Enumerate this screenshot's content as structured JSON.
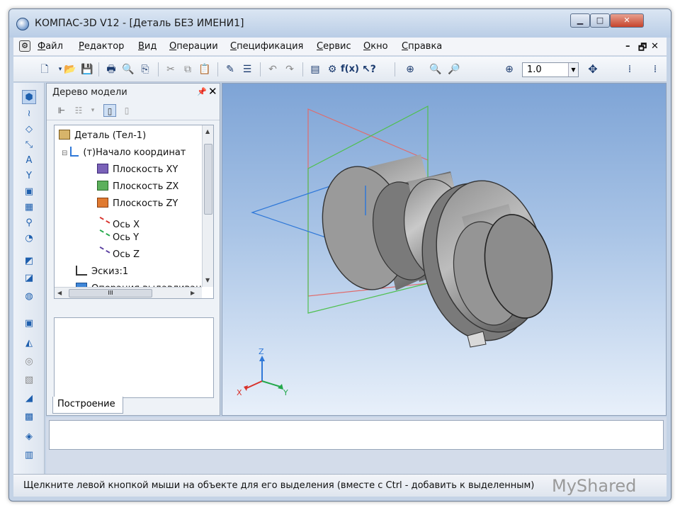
{
  "window": {
    "title": "КОМПАС-3D V12 - [Деталь БЕЗ ИМЕНИ1]",
    "controls": {
      "minimize": "▁",
      "maximize": "□",
      "close": "✕"
    }
  },
  "menu": {
    "items": [
      "Файл",
      "Редактор",
      "Вид",
      "Операции",
      "Спецификация",
      "Сервис",
      "Окно",
      "Справка"
    ],
    "mdi_controls": [
      "–",
      "🗗",
      "✕"
    ]
  },
  "toolbar": {
    "icons": [
      "new-document",
      "open-folder",
      "save",
      "print",
      "print-preview",
      "export",
      "cut",
      "copy",
      "paste",
      "format-brush",
      "properties",
      "undo",
      "redo",
      "manager",
      "variables",
      "formula",
      "context-help",
      "zoom-window",
      "zoom-in",
      "zoom-out",
      "zoom-scale",
      "pan"
    ],
    "formula_label": "f(x)",
    "zoom_value": "1.0"
  },
  "left_toolbar": {
    "icons": [
      "view-3d",
      "sketch-curve",
      "geometry",
      "dimensions",
      "designations",
      "edit",
      "parameterization",
      "measure",
      "filter",
      "library",
      "extrude",
      "rotate",
      "kinematic",
      "loft",
      "cut-extrude",
      "hole",
      "shell",
      "mirror",
      "array",
      "surfaces",
      "spec"
    ]
  },
  "model_tree": {
    "caption": "Дерево модели",
    "pin": "ᵾ",
    "close": "✕",
    "nodes": [
      {
        "label": "Деталь (Тел-1)",
        "icon": "part-icon"
      },
      {
        "label": "(т)Начало координат",
        "icon": "origin-icon"
      },
      {
        "label": "Плоскость XY",
        "icon": "plane-xy-icon"
      },
      {
        "label": "Плоскость ZX",
        "icon": "plane-zx-icon"
      },
      {
        "label": "Плоскость ZY",
        "icon": "plane-zy-icon"
      },
      {
        "label": "Ось X",
        "icon": "axis-x-icon"
      },
      {
        "label": "Ось Y",
        "icon": "axis-y-icon"
      },
      {
        "label": "Ось Z",
        "icon": "axis-z-icon"
      },
      {
        "label": "Эскиз:1",
        "icon": "sketch-icon"
      },
      {
        "label": "Операция выдавливания",
        "icon": "extrusion-icon"
      }
    ],
    "hscroll_thumb": "III",
    "tab": "Построение"
  },
  "viewport": {
    "axes": {
      "x": "X",
      "y": "Y",
      "z": "Z"
    },
    "axis_colors": {
      "x": "#d8322b",
      "y": "#22a84a",
      "z": "#2f78d8"
    },
    "plane_colors": {
      "xy": "#2f78d8",
      "zx": "#e06b6b",
      "zy": "#4fc04f"
    }
  },
  "status": {
    "text": "Щелкните левой кнопкой мыши на объекте для его выделения (вместе с Ctrl - добавить к выделенным)"
  },
  "watermark": "MyShared"
}
